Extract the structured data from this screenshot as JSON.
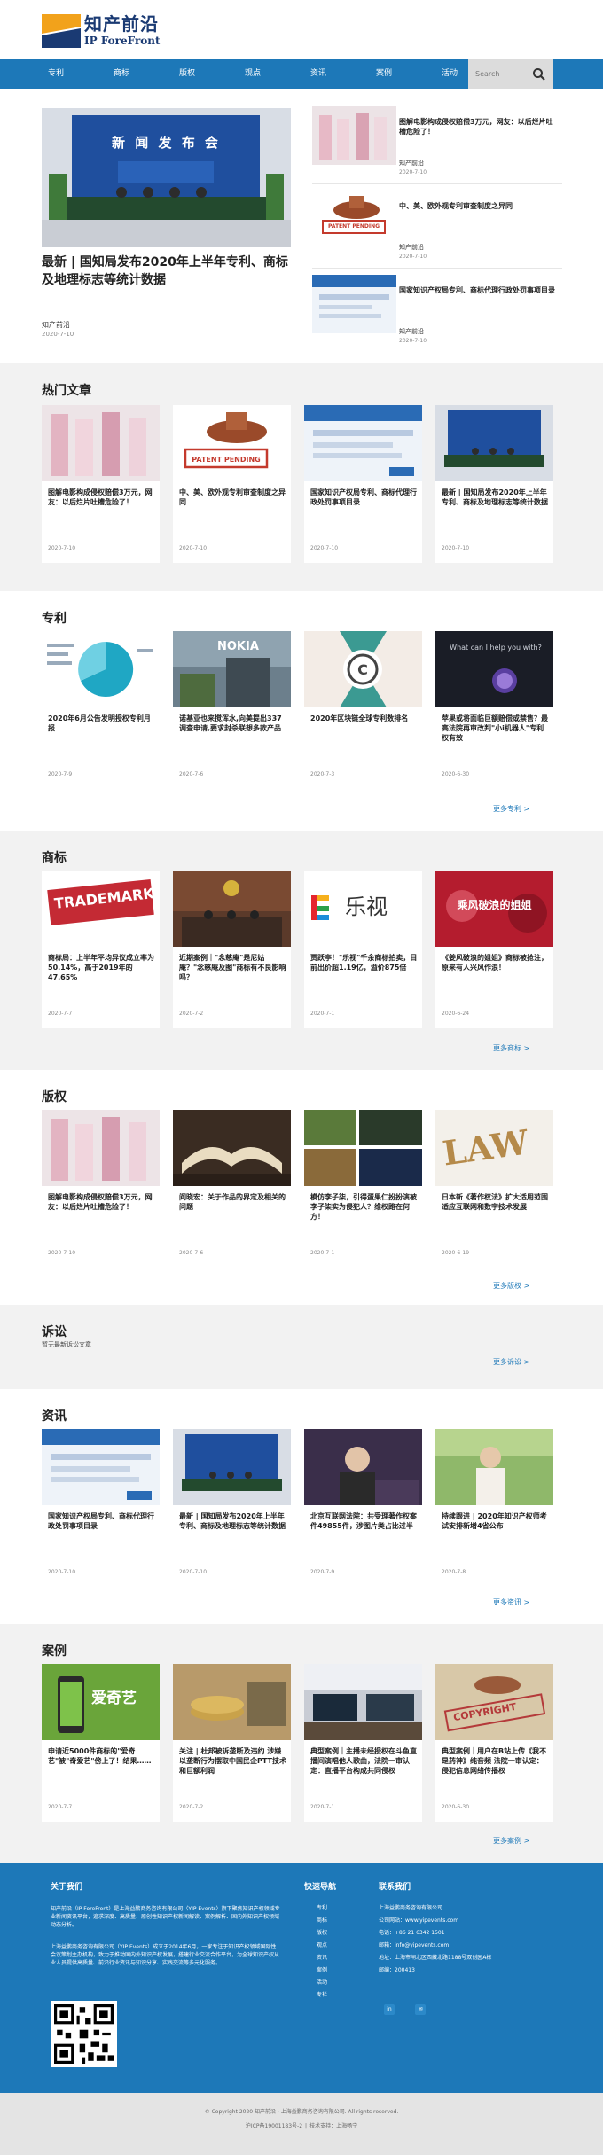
{
  "brand": {
    "cn": "知产前沿",
    "en": "IP ForeFront"
  },
  "nav": {
    "items": [
      "专利",
      "商标",
      "版权",
      "观点",
      "资讯",
      "案例",
      "活动",
      "专栏"
    ]
  },
  "search": {
    "placeholder": "Search"
  },
  "featured": {
    "main": {
      "title": "最新 | 国知局发布2020年上半年专利、商标及地理标志等统计数据",
      "source": "知产前沿",
      "date": "2020-7-10",
      "image_text": "新 闻 发 布 会"
    },
    "side": [
      {
        "title": "图解电影构成侵权赔偿3万元，网友：以后烂片吐槽危险了！",
        "source": "知产前沿",
        "date": "2020-7-10"
      },
      {
        "title": "中、美、欧外观专利审查制度之异同",
        "source": "知产前沿",
        "date": "2020-7-10",
        "stamp": "PATENT PENDING"
      },
      {
        "title": "国家知识产权局专利、商标代理行政处罚事项目录",
        "source": "知产前沿",
        "date": "2020-7-10"
      }
    ]
  },
  "hot": {
    "title": "热门文章",
    "items": [
      {
        "title": "图解电影构成侵权赔偿3万元，网友：以后烂片吐槽危险了！",
        "date": "2020-7-10"
      },
      {
        "title": "中、美、欧外观专利审查制度之异同",
        "date": "2020-7-10"
      },
      {
        "title": "国家知识产权局专利、商标代理行政处罚事项目录",
        "date": "2020-7-10"
      },
      {
        "title": "最新 | 国知局发布2020年上半年专利、商标及地理标志等统计数据",
        "date": "2020-7-10"
      }
    ]
  },
  "patent": {
    "title": "专利",
    "more": "更多专利 >",
    "items": [
      {
        "title": "2020年6月公告发明授权专利月报",
        "date": "2020-7-9"
      },
      {
        "title": "诺基亚也来搅浑水,向美提出337调查申请,要求封杀联想多款产品",
        "date": "2020-7-6",
        "image_text": "NOKIA"
      },
      {
        "title": "2020年区块链全球专利数排名",
        "date": "2020-7-3"
      },
      {
        "title": "苹果或将面临巨额赔偿或禁售？最高法院再审改判\"小i机器人\"专利权有效",
        "date": "2020-6-30",
        "image_text": "What can I help you with?"
      }
    ]
  },
  "trademark": {
    "title": "商标",
    "more": "更多商标 >",
    "items": [
      {
        "title": "商标局：上半年平均异议成立率为50.14%，高于2019年的47.65%",
        "date": "2020-7-7",
        "image_text": "TRADEMARK"
      },
      {
        "title": "近期案例｜\"念慈庵\"是尼姑庵？\"念慈庵及图\"商标有不良影响吗？",
        "date": "2020-7-2"
      },
      {
        "title": "贾跃亭！\"乐视\"千余商标拍卖，目前出价超1.19亿，溢价875倍",
        "date": "2020-7-1",
        "image_text": "乐视"
      },
      {
        "title": "《姜风破浪的姐姐》商标被抢注，原来有人兴风作浪！",
        "date": "2020-6-24",
        "image_text": "乘风破浪的姐姐"
      }
    ]
  },
  "copyright": {
    "title": "版权",
    "more": "更多版权 >",
    "items": [
      {
        "title": "图解电影构成侵权赔偿3万元，网友：以后烂片吐槽危险了！",
        "date": "2020-7-10"
      },
      {
        "title": "阎晓宏：关于作品的界定及相关的问题",
        "date": "2020-7-6"
      },
      {
        "title": "模仿李子柒，引得蛋果仁扮扮演被李子柒实为侵犯人？维权路在何方！",
        "date": "2020-7-1"
      },
      {
        "title": "日本新《著作权法》扩大适用范围 适应互联网和数字技术发展",
        "date": "2020-6-19",
        "image_text": "LAW"
      }
    ]
  },
  "litigation": {
    "title": "诉讼",
    "empty": "暂无最新诉讼文章",
    "more": "更多诉讼 >"
  },
  "news": {
    "title": "资讯",
    "more": "更多资讯 >",
    "items": [
      {
        "title": "国家知识产权局专利、商标代理行政处罚事项目录",
        "date": "2020-7-10"
      },
      {
        "title": "最新 | 国知局发布2020年上半年专利、商标及地理标志等统计数据",
        "date": "2020-7-10"
      },
      {
        "title": "北京互联网法院：共受理著作权案件49855件，涉图片类占比过半",
        "date": "2020-7-9"
      },
      {
        "title": "持续跟进 | 2020年知识产权师考试安排新增4省公布",
        "date": "2020-7-8"
      }
    ]
  },
  "cases": {
    "title": "案例",
    "more": "更多案例 >",
    "items": [
      {
        "title": "申请近5000件商标的\"爱奇艺\"被\"奇爱艺\"傍上了！结果……",
        "date": "2020-7-7",
        "image_text": "爱奇艺"
      },
      {
        "title": "关注 | 杜邦被诉垄断及违约 涉嫌以垄断行为摆取中国民企PTT技术和巨额利润",
        "date": "2020-7-2"
      },
      {
        "title": "典型案例｜主播未经授权在斗鱼直播间演唱他人歌曲，法院一审认定：直播平台构成共同侵权",
        "date": "2020-7-1"
      },
      {
        "title": "典型案例｜用户在B站上传《我不是药神》纯音频 法院一审认定：侵犯信息网络传播权",
        "date": "2020-6-30",
        "image_text": "COPYRIGHT"
      }
    ]
  },
  "footer": {
    "about_title": "关于我们",
    "about_p1": "知产前沿（IP ForeFront）是上海益鹏商务咨询有限公司（YIP Events）旗下聚焦知识产权领域专业新闻资讯平台，追求深度、高质量、原创性知识产权新闻解读、案例解析、国内外知识产权领域动态分析。",
    "about_p2": "上海益鹏商务咨询有限公司（YIP Events）成立于2014年6月，一家专注于知识产权领域国际性会议策划主办机构，致力于推动国内外知识产权发展，搭建行业交流合作平台，为全球知识产权从业人员提供高质量、前沿行业资讯与知识分享、实践交流等多元化服务。",
    "nav_title": "快速导航",
    "nav_items": [
      "专利",
      "商标",
      "版权",
      "观点",
      "资讯",
      "案例",
      "活动",
      "专栏"
    ],
    "contact_title": "联系我们",
    "contact": [
      "上海益鹏商务咨询有限公司",
      "公司网站：www.yipevents.com",
      "电话：+86 21 6342 1501",
      "邮箱：info@yipevents.com",
      "地址：上海市闸北区西藏北路1188号双创园A栋",
      "邮编：200413"
    ]
  },
  "copyright_bar": {
    "text": "© Copyright 2020 知产前沿 · 上海益鹏商务咨询有限公司. All rights reserved.",
    "links": [
      "沪ICP备19001183号-2",
      "技术支持：上海畅宁"
    ]
  },
  "colors": {
    "primary": "#1d78b8",
    "logo_orange": "#f2a21b",
    "logo_navy": "#1a3a73"
  }
}
